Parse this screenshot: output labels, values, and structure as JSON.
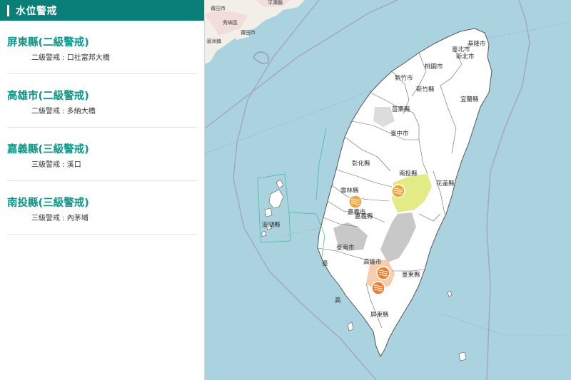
{
  "panel": {
    "title": "水位警戒",
    "alerts": [
      {
        "county": "屏東縣(二級警戒)",
        "station": "二級警戒 : 口社富邦大橋"
      },
      {
        "county": "高雄市(二級警戒)",
        "station": "二級警戒 : 多納大橋"
      },
      {
        "county": "嘉義縣(三級警戒)",
        "station": "三級警戒 : 溪口"
      },
      {
        "county": "南投縣(三級警戒)",
        "station": "三級警戒 : 內茅埔"
      }
    ]
  },
  "map": {
    "labels": {
      "keelung": "基隆市",
      "taipei": "臺北市",
      "new_taipei": "新北市",
      "taoyuan": "桃園市",
      "hsinchu_city": "新竹市",
      "hsinchu_county": "新竹縣",
      "yilan": "宜蘭縣",
      "miaoli": "苗栗縣",
      "taichung": "臺中市",
      "changhua": "彰化縣",
      "nantou": "南投縣",
      "hualien": "花蓮縣",
      "yunlin": "雲林縣",
      "chiayi_city": "嘉義市",
      "chiayi_county": "嘉義縣",
      "penghu": "澎湖縣",
      "tainan": "臺南市",
      "kaohsiung": "高雄市",
      "taitung": "臺東縣",
      "pingtung": "屏東縣",
      "tainan_partial": "臺",
      "kaohsiung_partial": "高",
      "putian": "莆田市",
      "xiuyu": "秀嶼區",
      "putian_small": "莆田市",
      "huiyu": "湄洲鎮",
      "pingtan": "平潭縣"
    },
    "colors": {
      "sea": "#aad3df",
      "land": "#ffffff",
      "level2": "#f7c6a6",
      "level3": "#e0ea7e",
      "marker": "#f2a33a",
      "grey_area": "#c8c8c8"
    },
    "markers": [
      {
        "name": "南投縣 內茅埔",
        "level": 3
      },
      {
        "name": "嘉義縣 溪口",
        "level": 3
      },
      {
        "name": "高雄市 多納大橋",
        "level": 2
      },
      {
        "name": "屏東縣 口社富邦大橋",
        "level": 2
      }
    ]
  }
}
